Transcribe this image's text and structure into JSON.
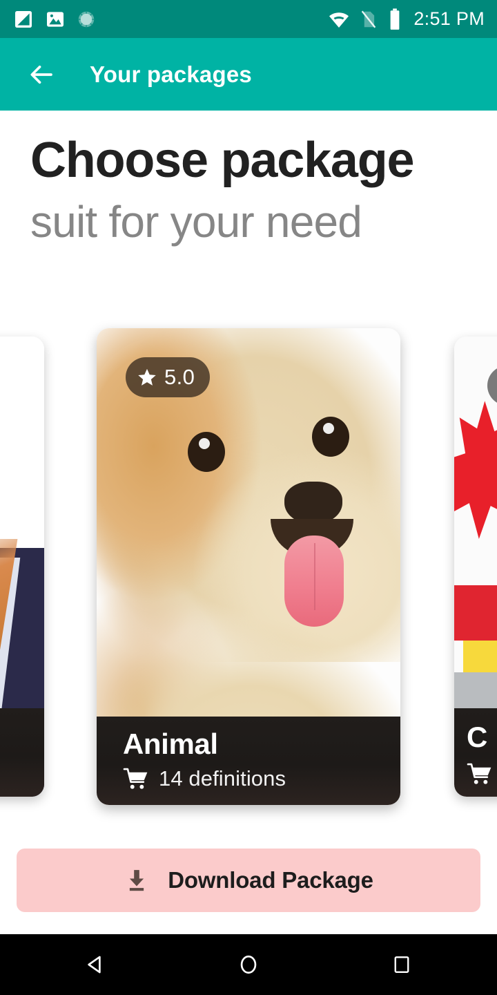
{
  "statusbar": {
    "time": "2:51 PM",
    "icons": [
      {
        "name": "screenshot-icon"
      },
      {
        "name": "image-icon"
      },
      {
        "name": "sync-progress-icon"
      },
      {
        "name": "wifi-icon"
      },
      {
        "name": "no-sim-icon"
      },
      {
        "name": "battery-icon"
      }
    ],
    "background_color": "#00897b"
  },
  "appbar": {
    "title": "Your packages",
    "back_icon": "arrow-left-icon",
    "background_color": "#00b3a4",
    "text_color": "#ffffff"
  },
  "headings": {
    "title": "Choose package",
    "subtitle": "suit for your need",
    "title_color": "#212121",
    "subtitle_color": "#868686"
  },
  "carousel": {
    "cards": [
      {
        "id": "food",
        "title": "",
        "rating": "",
        "definitions": "",
        "position": "left-peek",
        "image": "food-photo"
      },
      {
        "id": "animal",
        "title": "Animal",
        "rating": "5.0",
        "rating_icon": "star-icon",
        "definitions": "14 definitions",
        "cart_icon": "shopping-cart-icon",
        "position": "center",
        "image": "dog-photo"
      },
      {
        "id": "country",
        "title": "C",
        "rating": "",
        "definitions": "",
        "cart_icon": "shopping-cart-icon",
        "position": "right-peek",
        "image": "flag-photo"
      }
    ]
  },
  "download_button": {
    "label": "Download Package",
    "icon": "download-icon",
    "background_color": "#fbcbcb",
    "text_color": "#1d1d1d"
  },
  "navbar": {
    "background_color": "#000000",
    "buttons": [
      {
        "name": "back-nav-button",
        "icon": "triangle-back-icon"
      },
      {
        "name": "home-nav-button",
        "icon": "circle-home-icon"
      },
      {
        "name": "recents-nav-button",
        "icon": "square-recents-icon"
      }
    ]
  }
}
